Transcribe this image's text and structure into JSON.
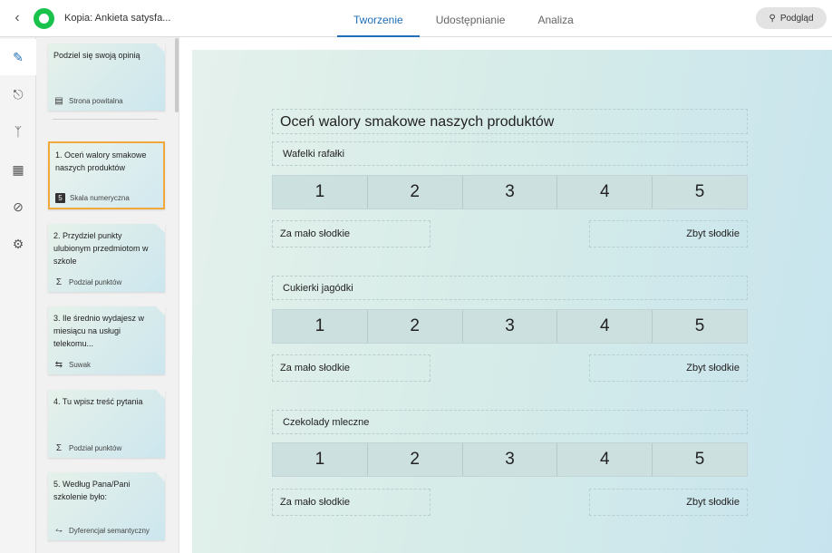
{
  "header": {
    "document_title": "Kopia: Ankieta satysfa...",
    "tabs": [
      "Tworzenie",
      "Udostępnianie",
      "Analiza"
    ],
    "active_tab": "Tworzenie",
    "preview_label": "Podgląd"
  },
  "rail": {
    "items": [
      "pencil-icon",
      "theme-icon",
      "branch-icon",
      "calculator-icon",
      "eye-slash-icon",
      "gear-icon"
    ],
    "active": "pencil-icon"
  },
  "questions": [
    {
      "title": "Podziel się swoją opinią",
      "type": "Strona powitalna",
      "icon": "welcome-page-icon"
    },
    {
      "title": "1. Oceń walory smakowe naszych produktów",
      "type": "Skala numeryczna",
      "icon": "numeric-scale-icon",
      "selected": true
    },
    {
      "title": "2. Przydziel punkty ulubionym przedmiotom w szkole",
      "type": "Podział punktów",
      "icon": "sigma-icon"
    },
    {
      "title": "3. Ile średnio wydajesz w miesiącu na usługi telekomu...",
      "type": "Suwak",
      "icon": "slider-icon"
    },
    {
      "title": "4. Tu wpisz treść pytania",
      "type": "Podział punktów",
      "icon": "sigma-icon"
    },
    {
      "title": "5. Według Pana/Pani szkolenie było:",
      "type": "Dyferencjał semantyczny",
      "icon": "semantic-differential-icon"
    }
  ],
  "editor": {
    "question_title": "Oceń walory smakowe naszych produktów",
    "rows": [
      {
        "label": "Wafelki rafałki",
        "scale": [
          "1",
          "2",
          "3",
          "4",
          "5"
        ],
        "min_label": "Za mało słodkie",
        "max_label": "Zbyt słodkie"
      },
      {
        "label": "Cukierki jagódki",
        "scale": [
          "1",
          "2",
          "3",
          "4",
          "5"
        ],
        "min_label": "Za mało słodkie",
        "max_label": "Zbyt słodkie"
      },
      {
        "label": "Czekolady mleczne",
        "scale": [
          "1",
          "2",
          "3",
          "4",
          "5"
        ],
        "min_label": "Za mało słodkie",
        "max_label": "Zbyt słodkie"
      }
    ]
  },
  "colors": {
    "accent": "#1d6fb8",
    "selected_border": "#f1a93b",
    "logo": "#19c24a"
  }
}
